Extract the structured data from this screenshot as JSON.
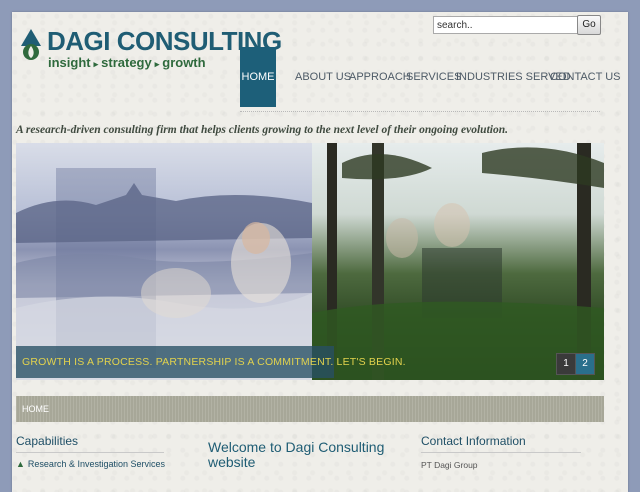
{
  "logo": {
    "title": "DAGI CONSULTING",
    "tagline": [
      "insight",
      "strategy",
      "growth"
    ],
    "icon": "leaf-drop-icon",
    "tagline_separator": "▸"
  },
  "search": {
    "value": "search..",
    "button_label": "Go"
  },
  "nav": {
    "items": [
      {
        "label": "HOME",
        "active": true
      },
      {
        "label": "ABOUT US",
        "active": false
      },
      {
        "label": "APPROACH",
        "active": false
      },
      {
        "label": "SERVICES",
        "active": false
      },
      {
        "label": "INDUSTRIES SERVED",
        "active": false
      },
      {
        "label": "CONTACT US",
        "active": false
      }
    ]
  },
  "tagline": "A research-driven consulting firm that helps clients growing to the next level of their ongoing evolution.",
  "slider": {
    "caption": "GROWTH IS A PROCESS. PARTNERSHIP IS A COMMITMENT. LET'S BEGIN.",
    "pages": [
      "1",
      "2"
    ],
    "active_page": "2"
  },
  "breadcrumb": "HOME",
  "capabilities": {
    "title": "Capabilities",
    "items": [
      "Research & Investigation Services"
    ]
  },
  "welcome": {
    "title": "Welcome to Dagi Consulting website"
  },
  "contact": {
    "title": "Contact Information",
    "lines": [
      "PT Dagi Group"
    ]
  },
  "colors": {
    "brand_blue": "#1f5d74",
    "brand_green": "#2f6a3d",
    "nav_active": "#1d5f79",
    "caption_text": "#e2d24d"
  }
}
